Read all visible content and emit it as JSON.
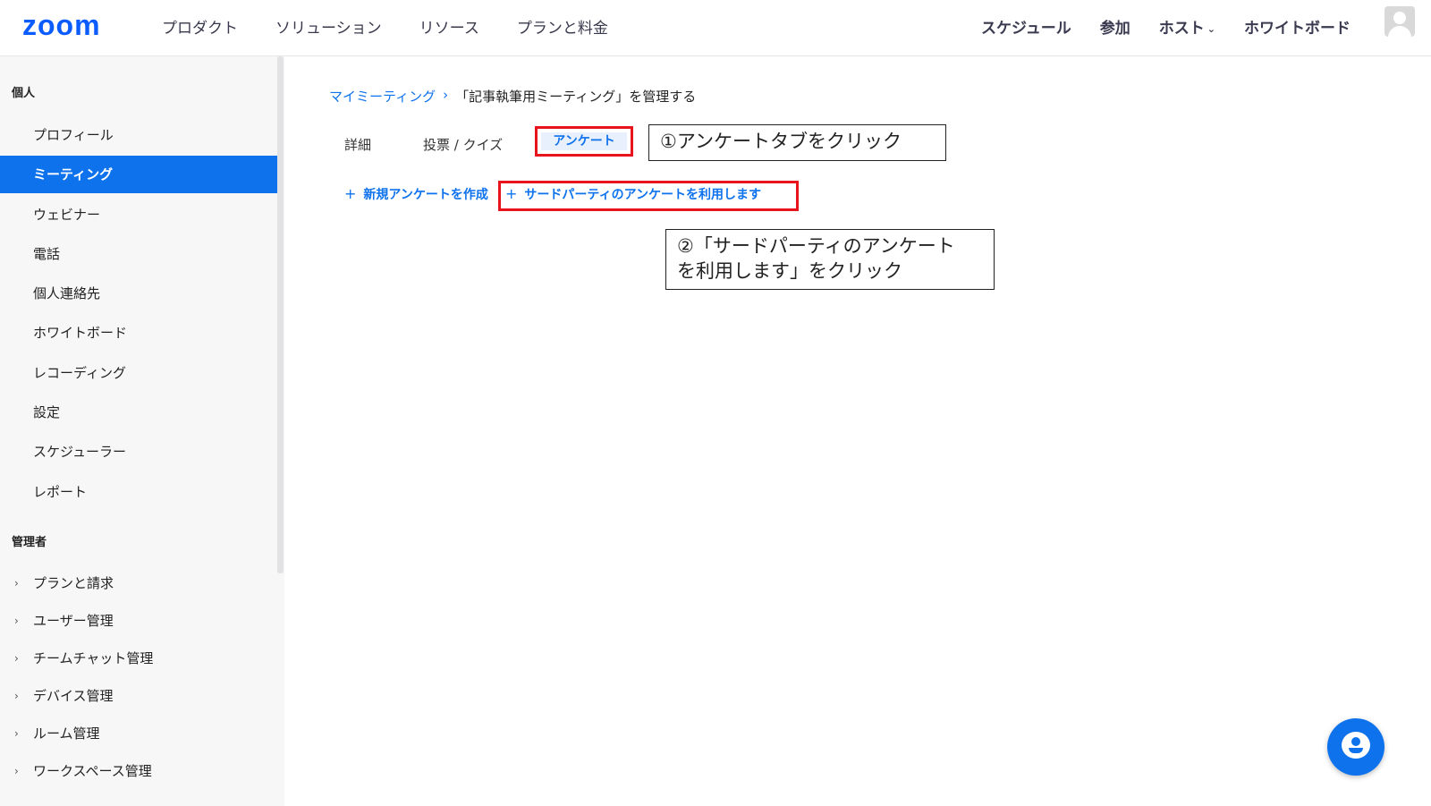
{
  "topnav": {
    "logo": "zoom",
    "left_items": [
      "プロダクト",
      "ソリューション",
      "リソース",
      "プランと料金"
    ],
    "right_items": {
      "schedule": "スケジュール",
      "join": "参加",
      "host": "ホスト",
      "whiteboard": "ホワイトボード"
    }
  },
  "sidebar": {
    "personal_title": "個人",
    "personal_items": [
      "プロフィール",
      "ミーティング",
      "ウェビナー",
      "電話",
      "個人連絡先",
      "ホワイトボード",
      "レコーディング",
      "設定",
      "スケジューラー",
      "レポート"
    ],
    "active_item": "ミーティング",
    "admin_title": "管理者",
    "admin_items": [
      "プランと請求",
      "ユーザー管理",
      "チームチャット管理",
      "デバイス管理",
      "ルーム管理",
      "ワークスペース管理"
    ]
  },
  "breadcrumb": {
    "link": "マイミーティング",
    "separator": "›",
    "current": "「記事執筆用ミーティング」を管理する"
  },
  "tabs": {
    "details": "詳細",
    "poll_quiz": "投票 / クイズ",
    "survey": "アンケート"
  },
  "actions": {
    "plus": "+",
    "new_survey": "新規アンケートを作成",
    "third_party": "サードパーティのアンケートを利用します"
  },
  "notes": {
    "step1": "①アンケートタブをクリック",
    "step2_line1": "②「サードパーティのアンケート",
    "step2_line2": "を利用します」をクリック"
  },
  "colors": {
    "accent": "#0e72ed",
    "highlight_red": "#e8141b",
    "logo_blue": "#0b5cff"
  }
}
